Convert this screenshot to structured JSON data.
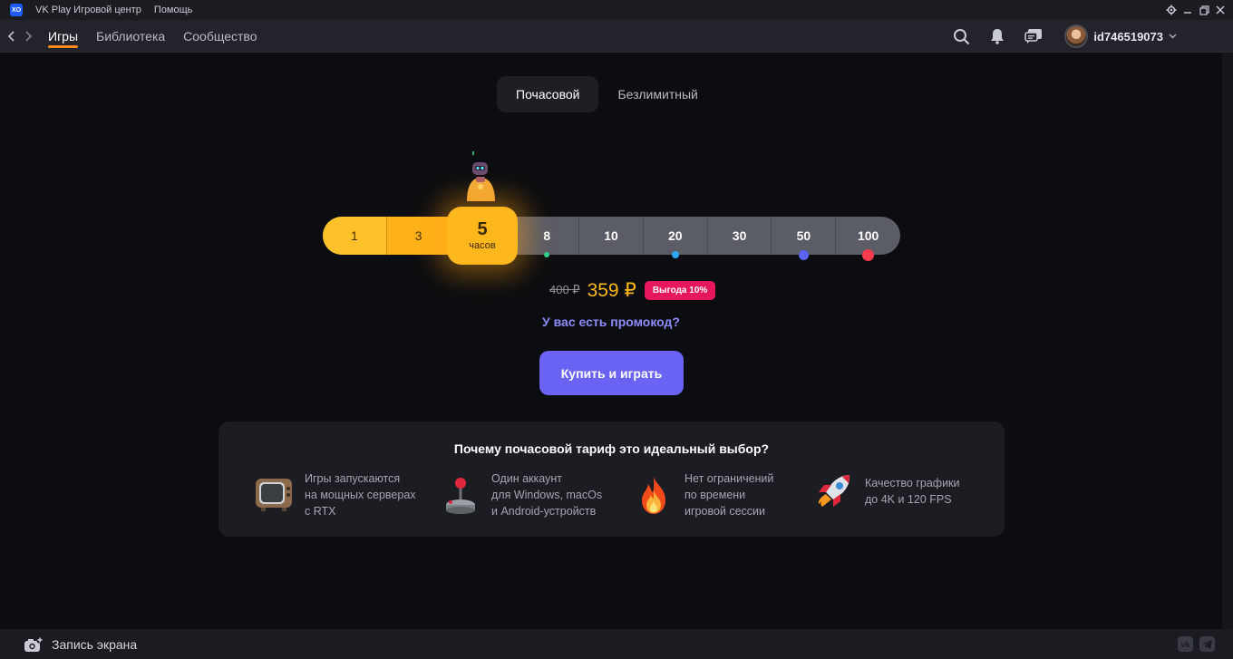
{
  "titlebar": {
    "app_title": "VK Play Игровой центр",
    "help": "Помощь",
    "icons": [
      "gear-icon",
      "minimize-icon",
      "restore-icon",
      "close-icon"
    ]
  },
  "nav": {
    "tabs": [
      {
        "label": "Игры",
        "active": true
      },
      {
        "label": "Библиотека",
        "active": false
      },
      {
        "label": "Сообщество",
        "active": false
      }
    ],
    "username": "id746519073",
    "icons": [
      "back-icon",
      "forward-icon",
      "search-icon",
      "bell-icon",
      "chat-icon",
      "chevron-down-icon"
    ]
  },
  "plan_tabs": [
    {
      "label": "Почасовой",
      "active": true
    },
    {
      "label": "Безлимитный",
      "active": false
    }
  ],
  "hours_slider": {
    "options": [
      "1",
      "3",
      "5",
      "8",
      "10",
      "20",
      "30",
      "50",
      "100"
    ],
    "selected": "5",
    "selected_unit": "часов",
    "dot_colors": {
      "8": "#2fd08a",
      "20": "#2aa7ff",
      "50": "#5b63ff",
      "100": "#ff3b4e"
    }
  },
  "price": {
    "old": "400 ₽",
    "new": "359 ₽",
    "badge": "Выгода 10%"
  },
  "promo_link": "У вас есть промокод?",
  "buy_button": "Купить и играть",
  "benefits": {
    "title": "Почему почасовой тариф это идеальный выбор?",
    "items": [
      {
        "icon": "tv-icon",
        "text": "Игры запускаются\nна мощных серверах\nс RTX"
      },
      {
        "icon": "joystick-icon",
        "text": "Один аккаунт\nдля Windows, macOs\nи Android-устройств"
      },
      {
        "icon": "fire-icon",
        "text": "Нет ограничений\nпо времени\nигровой сессии"
      },
      {
        "icon": "rocket-icon",
        "text": "Качество графики\nдо 4K и 120 FPS"
      }
    ]
  },
  "bottombar": {
    "record_label": "Запись экрана",
    "social_icons": [
      "vk-icon",
      "telegram-icon"
    ]
  },
  "colors": {
    "accent": "#ffb71c",
    "primary_button": "#6a63f5",
    "badge": "#e6175b",
    "link": "#8c8cff"
  }
}
